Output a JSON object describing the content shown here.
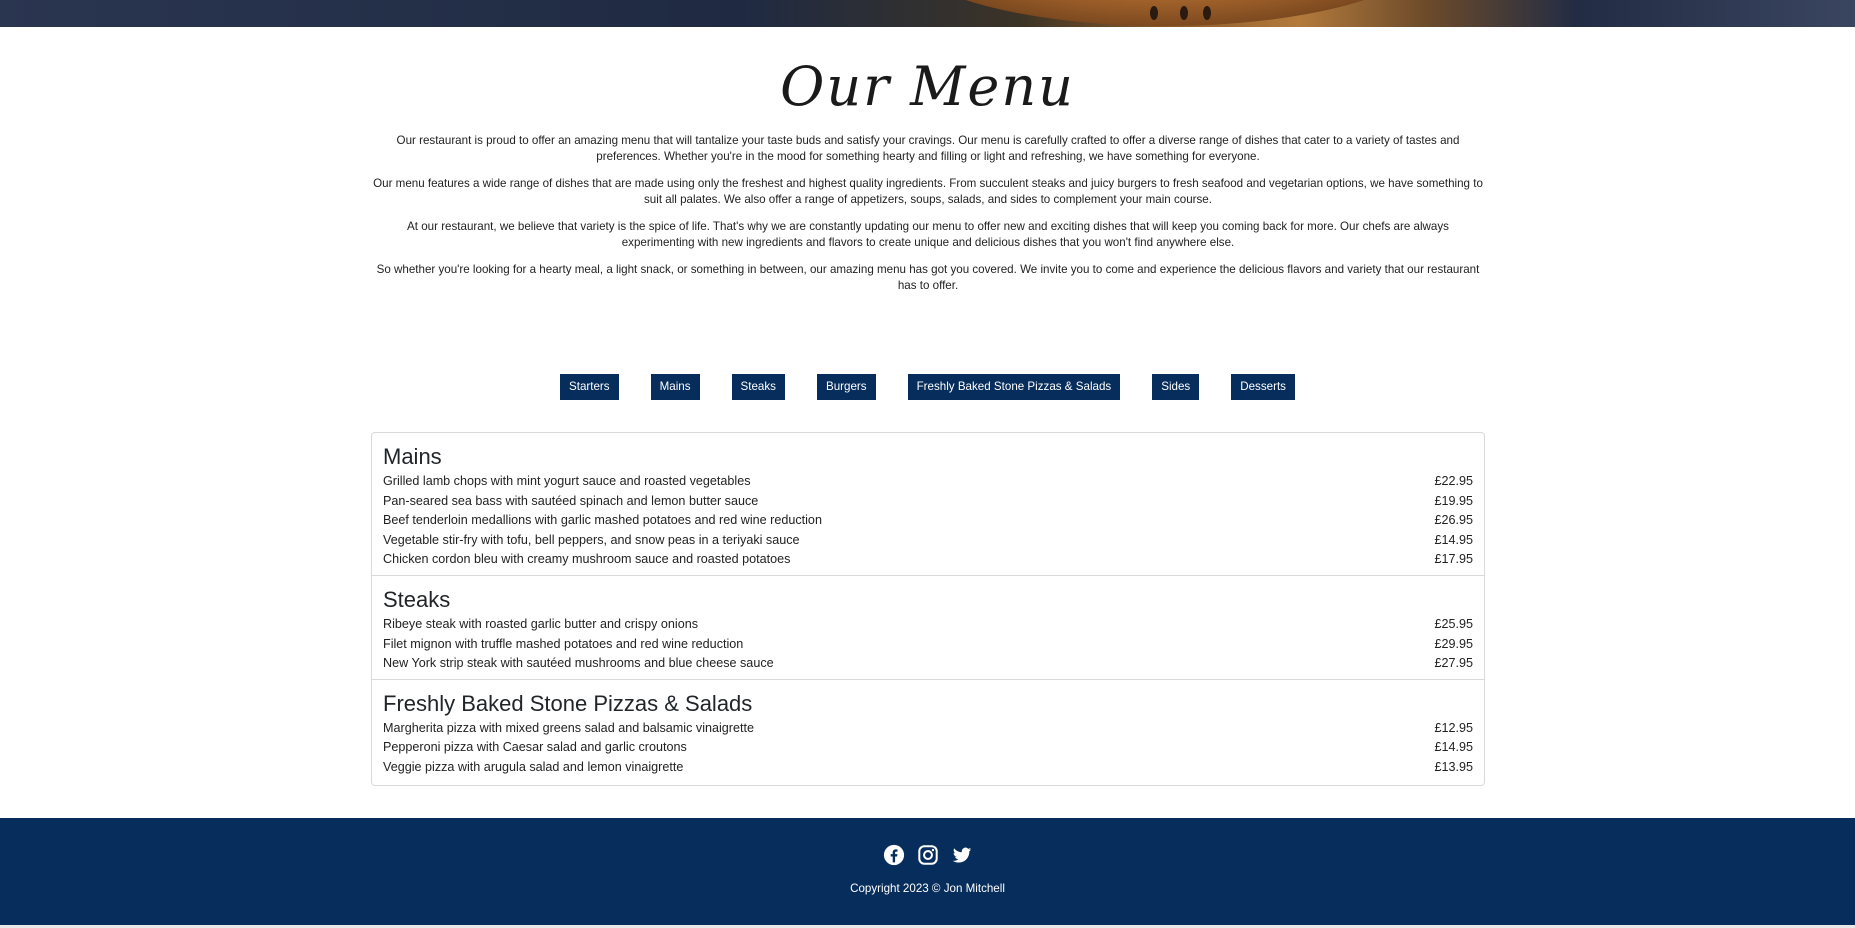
{
  "page": {
    "title": "Our Menu"
  },
  "intro": [
    "Our restaurant is proud to offer an amazing menu that will tantalize your taste buds and satisfy your cravings. Our menu is carefully crafted to offer a diverse range of dishes that cater to a variety of tastes and preferences. Whether you're in the mood for something hearty and filling or light and refreshing, we have something for everyone.",
    "Our menu features a wide range of dishes that are made using only the freshest and highest quality ingredients. From succulent steaks and juicy burgers to fresh seafood and vegetarian options, we have something to suit all palates. We also offer a range of appetizers, soups, salads, and sides to complement your main course.",
    "At our restaurant, we believe that variety is the spice of life. That's why we are constantly updating our menu to offer new and exciting dishes that will keep you coming back for more. Our chefs are always experimenting with new ingredients and flavors to create unique and delicious dishes that you won't find anywhere else.",
    "So whether you're looking for a hearty meal, a light snack, or something in between, our amazing menu has got you covered. We invite you to come and experience the delicious flavors and variety that our restaurant has to offer."
  ],
  "tabs": [
    "Starters",
    "Mains",
    "Steaks",
    "Burgers",
    "Freshly Baked Stone Pizzas & Salads",
    "Sides",
    "Desserts"
  ],
  "sections": [
    {
      "heading": "Mains",
      "items": [
        {
          "name": "Grilled lamb chops with mint yogurt sauce and roasted vegetables",
          "price": "£22.95"
        },
        {
          "name": "Pan-seared sea bass with sautéed spinach and lemon butter sauce",
          "price": "£19.95"
        },
        {
          "name": "Beef tenderloin medallions with garlic mashed potatoes and red wine reduction",
          "price": "£26.95"
        },
        {
          "name": "Vegetable stir-fry with tofu, bell peppers, and snow peas in a teriyaki sauce",
          "price": "£14.95"
        },
        {
          "name": "Chicken cordon bleu with creamy mushroom sauce and roasted potatoes",
          "price": "£17.95"
        }
      ]
    },
    {
      "heading": "Steaks",
      "items": [
        {
          "name": "Ribeye steak with roasted garlic butter and crispy onions",
          "price": "£25.95"
        },
        {
          "name": "Filet mignon with truffle mashed potatoes and red wine reduction",
          "price": "£29.95"
        },
        {
          "name": "New York strip steak with sautéed mushrooms and blue cheese sauce",
          "price": "£27.95"
        }
      ]
    },
    {
      "heading": "Freshly Baked Stone Pizzas & Salads",
      "items": [
        {
          "name": "Margherita pizza with mixed greens salad and balsamic vinaigrette",
          "price": "£12.95"
        },
        {
          "name": "Pepperoni pizza with Caesar salad and garlic croutons",
          "price": "£14.95"
        },
        {
          "name": "Veggie pizza with arugula salad and lemon vinaigrette",
          "price": "£13.95"
        }
      ]
    }
  ],
  "footer": {
    "social_icons": [
      "facebook-icon",
      "instagram-icon",
      "twitter-icon"
    ],
    "copyright": "Copyright 2023 © Jon Mitchell"
  },
  "colors": {
    "brand_navy": "#062d5b",
    "text": "#212529",
    "border": "#d9d9d9"
  }
}
